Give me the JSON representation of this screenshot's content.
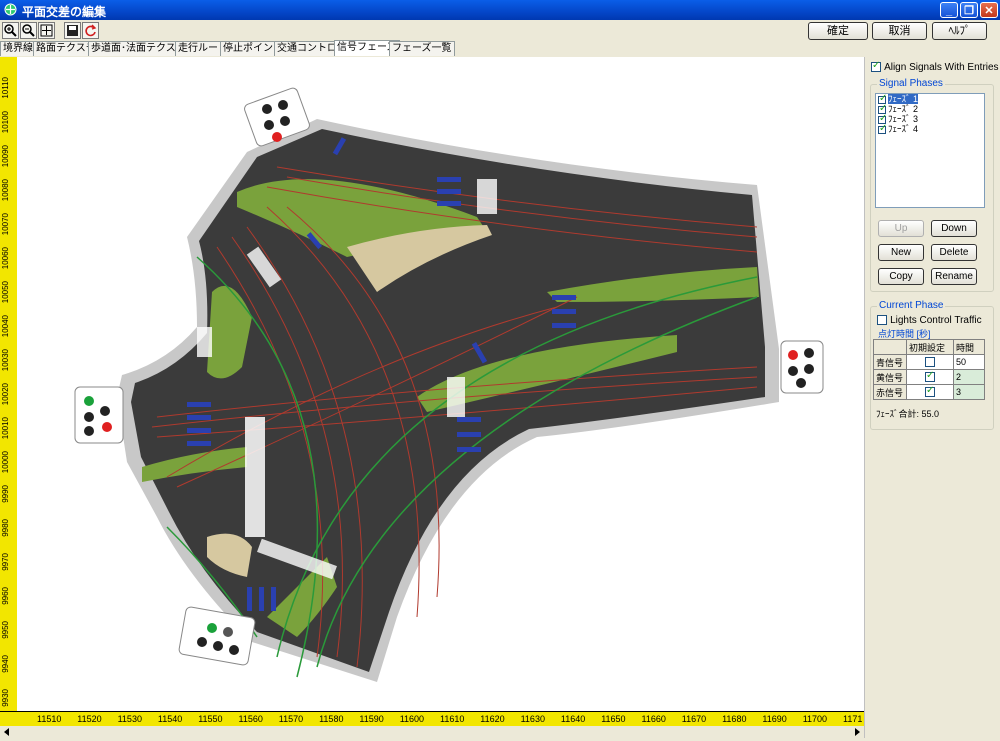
{
  "window": {
    "title": "平面交差の編集"
  },
  "actions": {
    "ok": "確定",
    "cancel": "取消",
    "help": "ﾍﾙﾌﾟ"
  },
  "tabs": [
    "境界線",
    "路面テクスチャ",
    "歩道面･法面テクスチャ",
    "走行ルート",
    "停止ポイント",
    "交通コントロール",
    "信号フェーズ",
    "フェーズ一覧"
  ],
  "ruler": {
    "x_labels": [
      "11510",
      "11520",
      "11530",
      "11540",
      "11550",
      "11560",
      "11570",
      "11580",
      "11590",
      "11600",
      "11610",
      "11620",
      "11630",
      "11640",
      "11650",
      "11660",
      "11670",
      "11680",
      "11690",
      "11700",
      "1171"
    ],
    "y_labels": [
      "10110",
      "10100",
      "10090",
      "10080",
      "10070",
      "10060",
      "10050",
      "10040",
      "10030",
      "10020",
      "10010",
      "10000",
      "9990",
      "9980",
      "9970",
      "9960",
      "9950",
      "9940",
      "9930"
    ]
  },
  "panel": {
    "align_label": "Align Signals With Entries",
    "phases_title": "Signal Phases",
    "phases": [
      "ﾌｪｰｽﾞ 1",
      "ﾌｪｰｽﾞ 2",
      "ﾌｪｰｽﾞ 3",
      "ﾌｪｰｽﾞ 4"
    ],
    "btn_up": "Up",
    "btn_down": "Down",
    "btn_new": "New",
    "btn_delete": "Delete",
    "btn_copy": "Copy",
    "btn_rename": "Rename",
    "current_title": "Current Phase",
    "lights_label": "Lights Control Traffic",
    "timing_title": "点灯時間 [秒]",
    "col_init": "初期設定",
    "col_time": "時間",
    "rows": [
      {
        "label": "青信号",
        "checked": false,
        "time": "50"
      },
      {
        "label": "黄信号",
        "checked": true,
        "time": "2"
      },
      {
        "label": "赤信号",
        "checked": true,
        "time": "3"
      }
    ],
    "total": "ﾌｪｰｽﾞ合計: 55.0"
  },
  "colors": {
    "asphalt": "#3b3b3b",
    "median": "#7aa23c",
    "sidewalk": "#c8c8c8",
    "lane_red": "#b03a2e",
    "lane_green": "#2a9a3a",
    "marker_blue": "#2a40b0",
    "signal_red": "#e02020",
    "signal_green": "#1aa13a"
  }
}
